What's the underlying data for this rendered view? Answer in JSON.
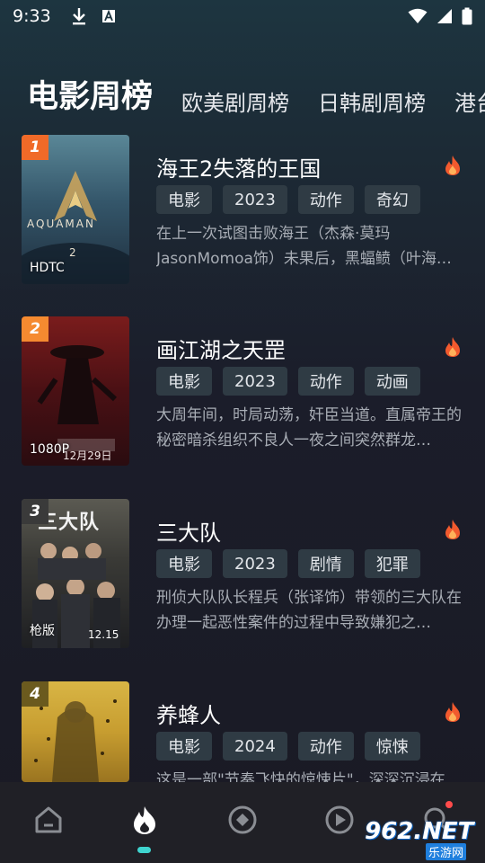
{
  "status": {
    "time": "9:33"
  },
  "tabs": [
    {
      "label": "电影周榜",
      "active": true
    },
    {
      "label": "欧美剧周榜"
    },
    {
      "label": "日韩剧周榜"
    },
    {
      "label": "港台"
    }
  ],
  "items": [
    {
      "rank": "1",
      "rank_color": "#f06a28",
      "quality": "HDTC",
      "title": "海王2失落的王国",
      "tags": [
        "电影",
        "2023",
        "动作",
        "奇幻"
      ],
      "desc": "在上一次试图击败海王（杰森·莫玛 JasonMomoa饰）未果后，黑蝠鲼（叶海…"
    },
    {
      "rank": "2",
      "rank_color": "#f58a30",
      "quality": "1080P",
      "title": "画江湖之天罡",
      "tags": [
        "电影",
        "2023",
        "动作",
        "动画"
      ],
      "desc": "大周年间，时局动荡，奸臣当道。直属帝王的秘密暗杀组织不良人一夜之间突然群龙…"
    },
    {
      "rank": "3",
      "rank_color": "#3a3a3a",
      "quality": "枪版",
      "title": "三大队",
      "tags": [
        "电影",
        "2023",
        "剧情",
        "犯罪"
      ],
      "desc": "刑侦大队队长程兵（张译饰）带领的三大队在办理一起恶性案件的过程中导致嫌犯之…"
    },
    {
      "rank": "4",
      "rank_color": "#6b5a1e",
      "quality": "",
      "title": "养蜂人",
      "tags": [
        "电影",
        "2024",
        "动作",
        "惊悚"
      ],
      "desc": "这是一部\"节奏飞快的惊悚片\"，深深沉浸在…"
    }
  ],
  "poster_texts": {
    "aquaman": "AQUAMAN",
    "aquaman_2": "2",
    "tiangang_date": "12月29日",
    "sandadui_title": "三大队",
    "sandadui_date": "12.15"
  },
  "nav": [
    {
      "name": "home-icon"
    },
    {
      "name": "fire-icon",
      "active": true
    },
    {
      "name": "discover-icon"
    },
    {
      "name": "play-icon"
    },
    {
      "name": "search-icon"
    }
  ],
  "watermark": {
    "main": "962.NET",
    "sub": "乐游网"
  }
}
